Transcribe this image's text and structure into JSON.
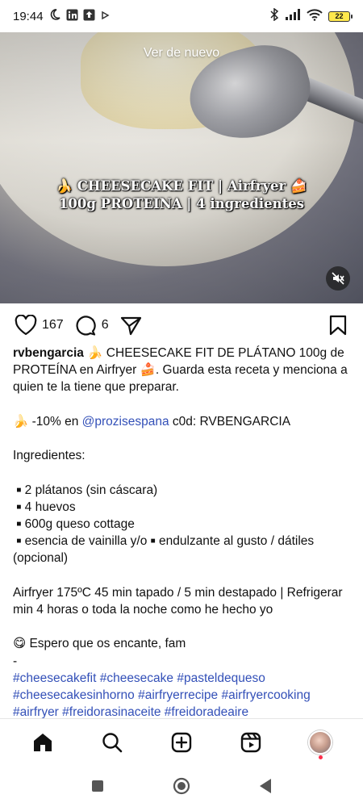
{
  "status_bar": {
    "time": "19:44",
    "battery_level": "22",
    "icons": [
      "moon-icon",
      "linkedin-icon",
      "upload-icon",
      "play-icon",
      "bluetooth-icon",
      "signal-icon",
      "wifi-icon",
      "battery-icon"
    ]
  },
  "video": {
    "replay_label": "Ver de nuevo",
    "title_line1": "🍌 CHEESECAKE FIT | Airfryer 🍰",
    "title_line2": "100g PROTEINA | 4 ingredientes",
    "muted": true
  },
  "actions": {
    "likes": "167",
    "comments": "6"
  },
  "caption": {
    "username": "rvbengarcia",
    "intro": " 🍌 CHEESECAKE FIT DE PLÁTANO 100g de PROTEÍNA en Airfryer 🍰. Guarda esta receta y menciona a quien te la tiene que preparar.",
    "discount_prefix": "🍌 -10% en ",
    "discount_mention": "@prozisespana",
    "discount_suffix": " c0d: RVBENGARCIA",
    "ingredients_heading": "Ingredientes:",
    "ingredients": [
      "2 plátanos (sin cáscara)",
      "4 huevos",
      "600g queso cottage",
      "esencia de vainilla y/o "
    ],
    "ingredient_extra": " endulzante al gusto / dátiles (opcional)",
    "instructions": "Airfryer 175ºC 45 min tapado / 5 min destapado | Refrigerar min 4 horas o toda la noche como he hecho yo",
    "closing": "😋 Espero que os encante, fam",
    "separator": "-",
    "hashtags": "#cheesecakefit #cheesecake #pasteldequeso #cheesecakesinhorno #airfryerrecipe #airfryercooking #airfryer #freidorasinaceite #freidoradeaire"
  },
  "bottom_nav": {
    "items": [
      "home-icon",
      "search-icon",
      "create-icon",
      "reels-icon",
      "profile-avatar"
    ],
    "active": "home-icon"
  },
  "colors": {
    "link": "#3350b8",
    "notification_dot": "#ff2d4a"
  }
}
